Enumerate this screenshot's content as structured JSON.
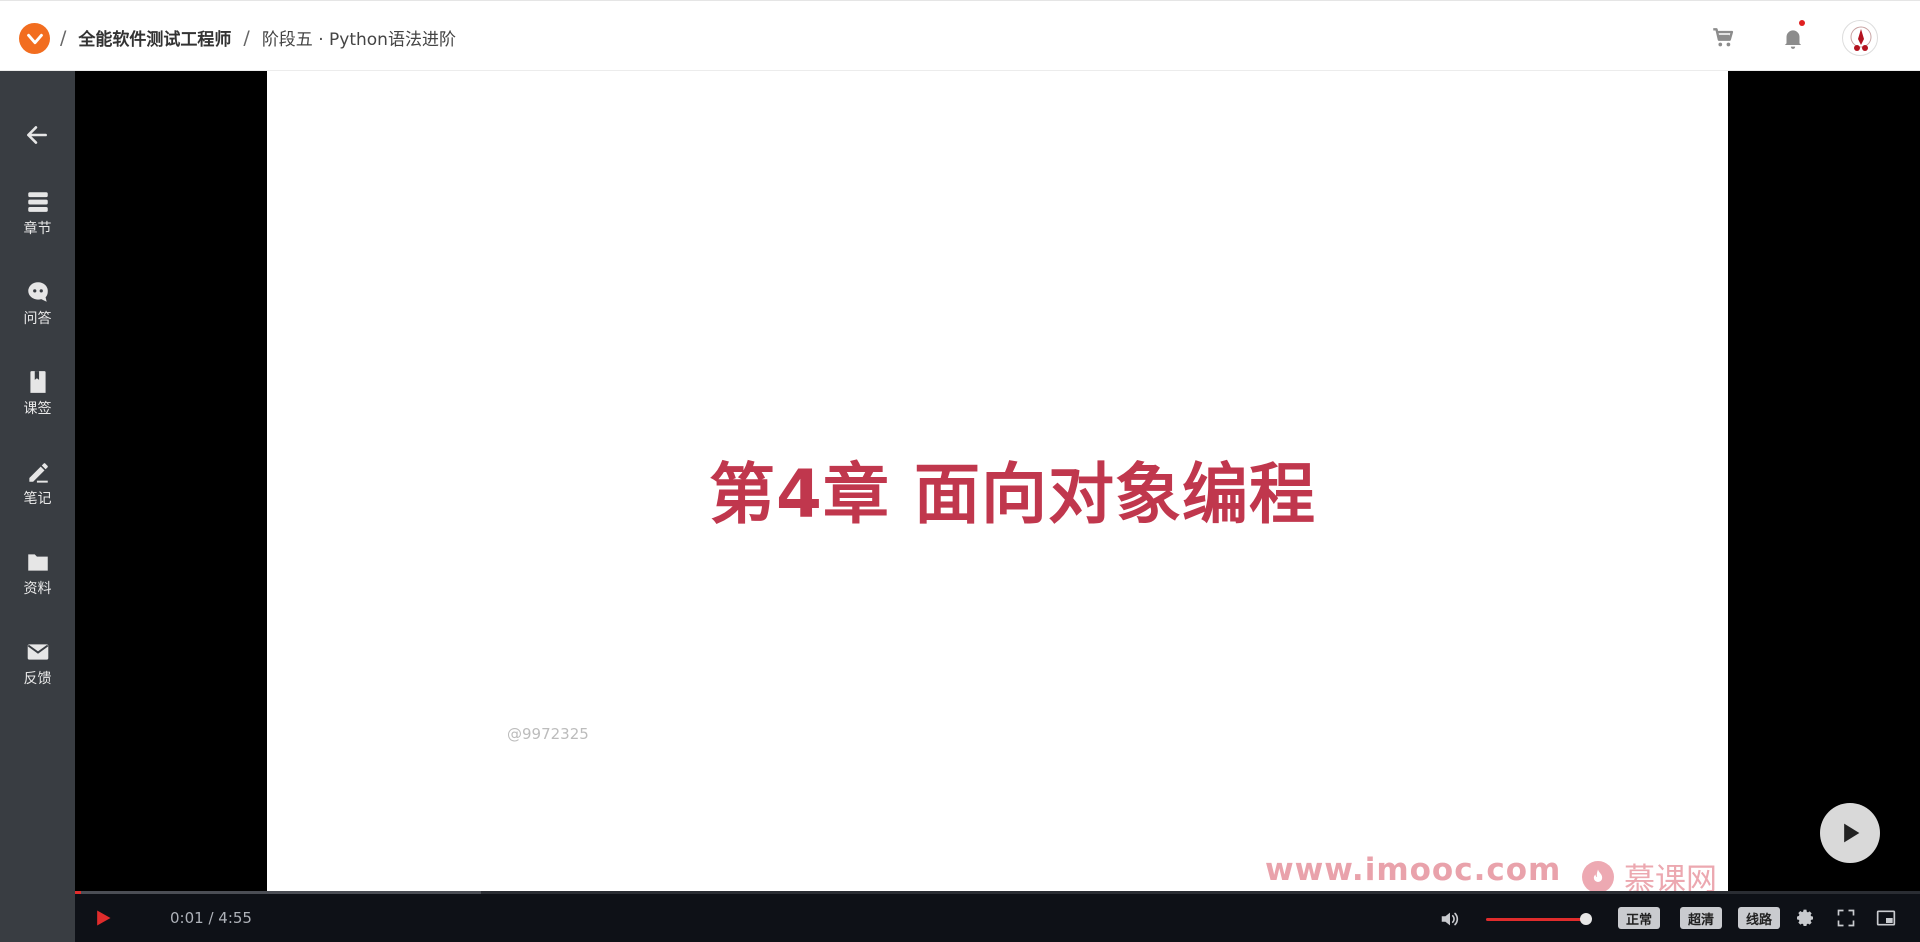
{
  "header": {
    "breadcrumb_sep": "/",
    "course_title": "全能软件测试工程师",
    "stage_title": "阶段五 · Python语法进阶"
  },
  "sidebar": {
    "items": [
      {
        "label": "章节",
        "icon": "chapters-icon"
      },
      {
        "label": "问答",
        "icon": "qa-icon"
      },
      {
        "label": "课签",
        "icon": "bookmark-icon"
      },
      {
        "label": "笔记",
        "icon": "note-icon"
      },
      {
        "label": "资料",
        "icon": "folder-icon"
      },
      {
        "label": "反馈",
        "icon": "mail-icon"
      }
    ]
  },
  "slide": {
    "title": "第4章 面向对象编程",
    "watermark": "@9972325",
    "site_url": "www.imooc.com",
    "brand": "慕课网"
  },
  "player": {
    "time": "0:01 / 4:55",
    "speed_label": "正常",
    "quality_label": "超清",
    "route_label": "线路",
    "progress_fraction": 0.003,
    "buffer_fraction": 0.22,
    "volume_fraction": 1.0
  },
  "colors": {
    "accent": "#e02c2c",
    "brand_orange": "#f26d1f",
    "slide_title": "#c0374d",
    "sidebar_bg": "#393d42"
  }
}
